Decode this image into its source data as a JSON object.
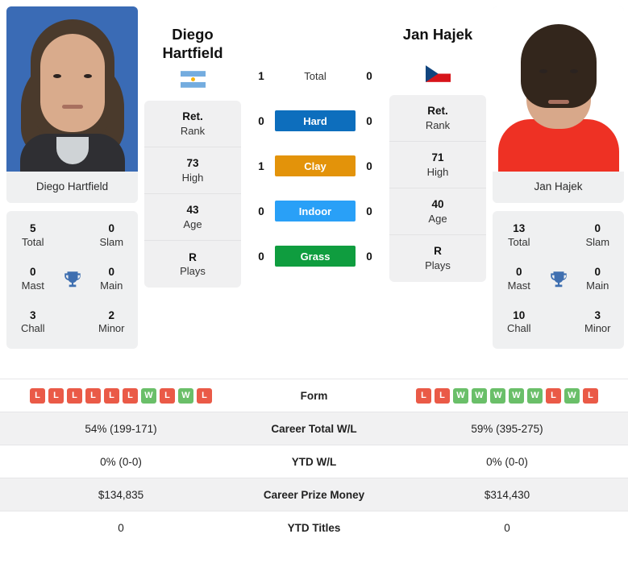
{
  "players": {
    "left": {
      "first_name": "Diego",
      "last_name": "Hartfield",
      "full_name": "Diego Hartfield",
      "photo_name_caption": "Diego Hartfield",
      "country": "Argentina",
      "flag_icon": "flag-argentina-icon",
      "info": [
        {
          "value": "Ret.",
          "label": "Rank"
        },
        {
          "value": "73",
          "label": "High"
        },
        {
          "value": "43",
          "label": "Age"
        },
        {
          "value": "R",
          "label": "Plays"
        }
      ],
      "titles": {
        "total": "5",
        "total_label": "Total",
        "slam": "0",
        "slam_label": "Slam",
        "mast": "0",
        "mast_label": "Mast",
        "main": "0",
        "main_label": "Main",
        "chall": "3",
        "chall_label": "Chall",
        "minor": "2",
        "minor_label": "Minor"
      },
      "form": [
        "L",
        "L",
        "L",
        "L",
        "L",
        "L",
        "W",
        "L",
        "W",
        "L"
      ],
      "career_total_wl": "54% (199-171)",
      "ytd_wl": "0% (0-0)",
      "career_prize_money": "$134,835",
      "ytd_titles": "0"
    },
    "right": {
      "first_name": "Jan",
      "last_name": "Hajek",
      "full_name": "Jan Hajek",
      "photo_name_caption": "Jan Hajek",
      "country": "Czech Republic",
      "flag_icon": "flag-czech-republic-icon",
      "info": [
        {
          "value": "Ret.",
          "label": "Rank"
        },
        {
          "value": "71",
          "label": "High"
        },
        {
          "value": "40",
          "label": "Age"
        },
        {
          "value": "R",
          "label": "Plays"
        }
      ],
      "titles": {
        "total": "13",
        "total_label": "Total",
        "slam": "0",
        "slam_label": "Slam",
        "mast": "0",
        "mast_label": "Mast",
        "main": "0",
        "main_label": "Main",
        "chall": "10",
        "chall_label": "Chall",
        "minor": "3",
        "minor_label": "Minor"
      },
      "form": [
        "L",
        "L",
        "W",
        "W",
        "W",
        "W",
        "W",
        "L",
        "W",
        "L"
      ],
      "career_total_wl": "59% (395-275)",
      "ytd_wl": "0% (0-0)",
      "career_prize_money": "$314,430",
      "ytd_titles": "0"
    }
  },
  "head_to_head": [
    {
      "label": "Total",
      "left": "1",
      "right": "0",
      "styled": false,
      "color": ""
    },
    {
      "label": "Hard",
      "left": "0",
      "right": "0",
      "styled": true,
      "color": "#0d6ebd"
    },
    {
      "label": "Clay",
      "left": "1",
      "right": "0",
      "styled": true,
      "color": "#e3930a"
    },
    {
      "label": "Indoor",
      "left": "0",
      "right": "0",
      "styled": true,
      "color": "#29a0f7"
    },
    {
      "label": "Grass",
      "left": "0",
      "right": "0",
      "styled": true,
      "color": "#0f9d3f"
    }
  ],
  "stats_rows": [
    {
      "label": "Form",
      "type": "form"
    },
    {
      "label": "Career Total W/L",
      "type": "text",
      "key": "career_total_wl"
    },
    {
      "label": "YTD W/L",
      "type": "text",
      "key": "ytd_wl"
    },
    {
      "label": "Career Prize Money",
      "type": "text",
      "key": "career_prize_money"
    },
    {
      "label": "YTD Titles",
      "type": "text",
      "key": "ytd_titles"
    }
  ],
  "colors": {
    "win_badge": "#6abf69",
    "loss_badge": "#ea5a47",
    "trophy": "#3f6fb0",
    "card_bg": "#eff0f1",
    "row_shade": "#f1f1f2"
  },
  "icons": {
    "trophy": "trophy-icon"
  }
}
